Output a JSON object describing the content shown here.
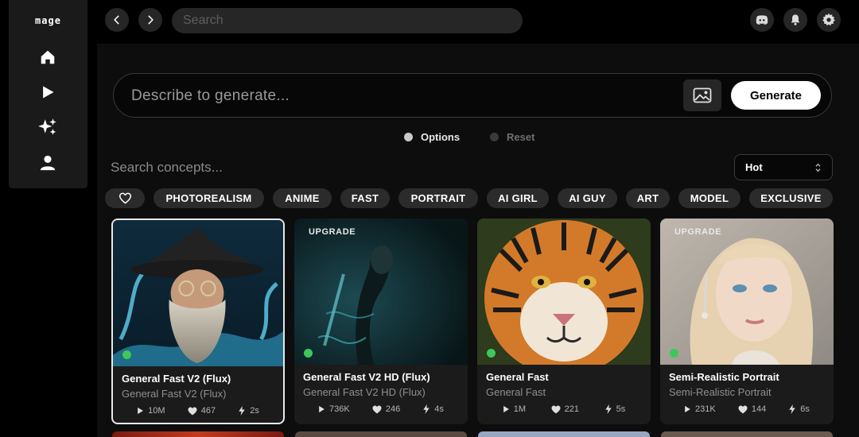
{
  "sidebar": {
    "logo": "mage"
  },
  "topbar": {
    "search_placeholder": "Search"
  },
  "prompt": {
    "placeholder": "Describe to generate...",
    "generate_label": "Generate"
  },
  "toggles": {
    "options_label": "Options",
    "reset_label": "Reset"
  },
  "concepts": {
    "search_placeholder": "Search concepts...",
    "sort_value": "Hot"
  },
  "tags": [
    "PHOTOREALISM",
    "ANIME",
    "FAST",
    "PORTRAIT",
    "AI GIRL",
    "AI GUY",
    "ART",
    "MODEL",
    "EXCLUSIVE"
  ],
  "cards": [
    {
      "title": "General Fast V2 (Flux)",
      "subtitle": "General Fast V2 (Flux)",
      "runs": "10M",
      "likes": "467",
      "speed": "2s",
      "badge": ""
    },
    {
      "title": "General Fast V2 HD (Flux)",
      "subtitle": "General Fast V2 HD (Flux)",
      "runs": "736K",
      "likes": "246",
      "speed": "4s",
      "badge": "UPGRADE"
    },
    {
      "title": "General Fast",
      "subtitle": "General Fast",
      "runs": "1M",
      "likes": "221",
      "speed": "5s",
      "badge": ""
    },
    {
      "title": "Semi-Realistic Portrait",
      "subtitle": "Semi-Realistic Portrait",
      "runs": "231K",
      "likes": "144",
      "speed": "6s",
      "badge": "UPGRADE"
    }
  ],
  "colors": {
    "accent_white": "#ffffff",
    "live_green": "#3ec85b",
    "panel": "#1b1b1b",
    "chip": "#2b2b2b"
  }
}
